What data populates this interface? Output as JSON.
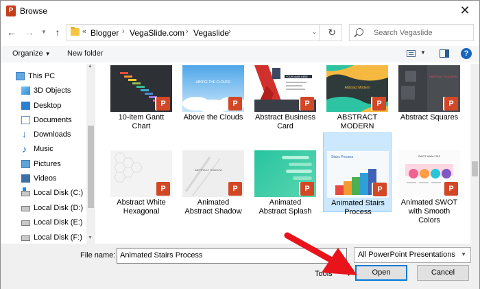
{
  "window": {
    "title": "Browse",
    "app_icon": "powerpoint-icon"
  },
  "address_bar": {
    "overflow": "«",
    "crumbs": [
      "Blogger",
      "VegaSlide.com",
      "Vegaslide"
    ]
  },
  "search": {
    "placeholder": "Search Vegaslide"
  },
  "toolbar": {
    "organize": "Organize",
    "new_folder": "New folder",
    "help": "?"
  },
  "sidebar": {
    "items": [
      {
        "label": "This PC",
        "icon": "pc-icon"
      },
      {
        "label": "3D Objects",
        "icon": "cube-icon"
      },
      {
        "label": "Desktop",
        "icon": "desktop-icon"
      },
      {
        "label": "Documents",
        "icon": "documents-icon"
      },
      {
        "label": "Downloads",
        "icon": "download-icon"
      },
      {
        "label": "Music",
        "icon": "music-icon"
      },
      {
        "label": "Pictures",
        "icon": "pictures-icon"
      },
      {
        "label": "Videos",
        "icon": "videos-icon"
      },
      {
        "label": "Local Disk (C:)",
        "icon": "windows-disk-icon"
      },
      {
        "label": "Local Disk (D:)",
        "icon": "disk-icon"
      },
      {
        "label": "Local Disk (E:)",
        "icon": "disk-icon"
      },
      {
        "label": "Local Disk (F:)",
        "icon": "disk-icon"
      }
    ]
  },
  "files": [
    {
      "name": "10-item Gantt Chart",
      "line1": "10-item Gantt",
      "line2": "Chart",
      "selected": false
    },
    {
      "name": "Above the Clouds",
      "line1": "Above the Clouds",
      "line2": "",
      "selected": false
    },
    {
      "name": "Abstract Business Card",
      "line1": "Abstract Business",
      "line2": "Card",
      "selected": false
    },
    {
      "name": "ABSTRACT MODERN",
      "line1": "ABSTRACT",
      "line2": "MODERN",
      "selected": false
    },
    {
      "name": "Abstract Squares",
      "line1": "Abstract Squares",
      "line2": "",
      "selected": false
    },
    {
      "name": "Abstract White Hexagonal",
      "line1": "Abstract White",
      "line2": "Hexagonal",
      "selected": false
    },
    {
      "name": "Animated Abstract Shadow",
      "line1": "Animated",
      "line2": "Abstract Shadow",
      "selected": false
    },
    {
      "name": "Animated Abstract Splash",
      "line1": "Animated",
      "line2": "Abstract Splash",
      "selected": false
    },
    {
      "name": "Animated Stairs Process",
      "line1": "Animated Stairs",
      "line2": "Process",
      "selected": true
    },
    {
      "name": "Animated SWOT with Smooth Colors",
      "line1": "Animated SWOT",
      "line2": "with Smooth",
      "line3": "Colors",
      "selected": false
    }
  ],
  "thumb_text": {
    "clouds": "ABOVE THE CLOUDS",
    "card_name": "YOUR NAME HERE",
    "abstract_modern": "Abstract Modern",
    "squares": "ABSTRACT SQUARES",
    "shadow": "ABSTRACT SHADOW",
    "stairs": "Stairs Process",
    "swot": "SWOT ANALYSIS"
  },
  "bottom": {
    "file_name_label": "File name:",
    "file_name_value": "Animated Stairs Process",
    "file_type": "All PowerPoint Presentations",
    "tools": "Tools",
    "open": "Open",
    "cancel": "Cancel"
  },
  "colors": {
    "selection": "#cce8ff",
    "powerpoint": "#d24726",
    "arrow": "#e8131b"
  }
}
